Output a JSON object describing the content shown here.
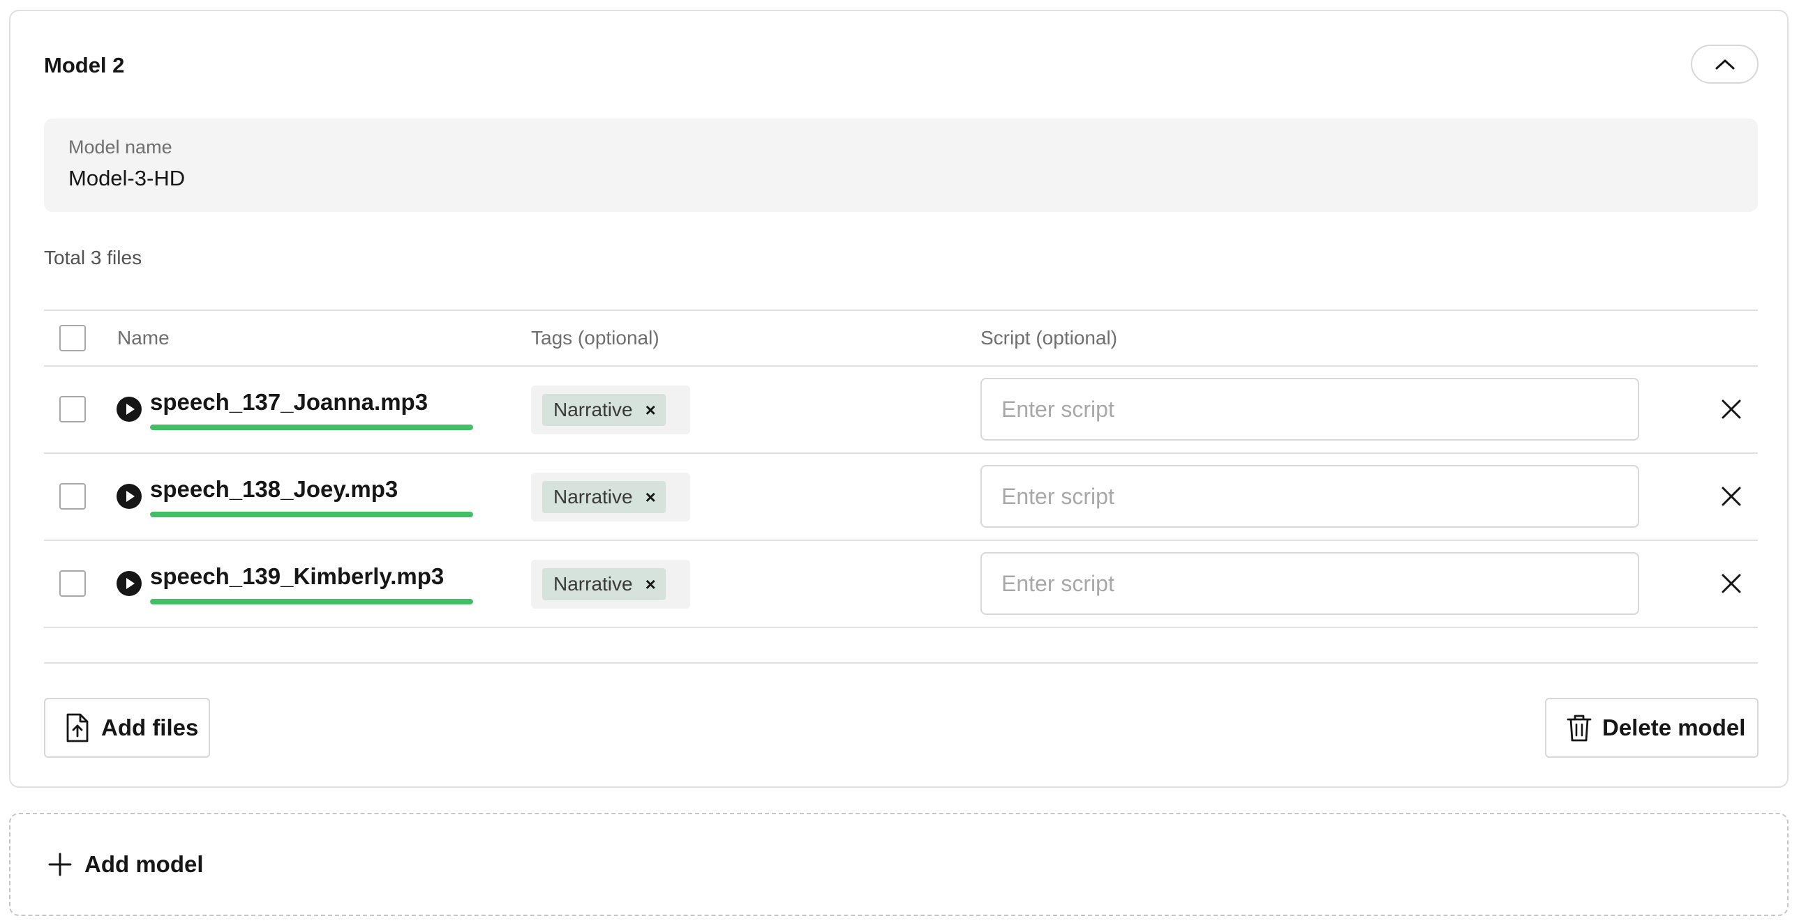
{
  "model": {
    "title": "Model 2",
    "collapse_icon": "chevron-up-icon",
    "name_label": "Model name",
    "name_value": "Model-3-HD",
    "total_files": "Total 3 files"
  },
  "table": {
    "headers": {
      "name": "Name",
      "tags": "Tags (optional)",
      "script": "Script (optional)"
    },
    "rows": [
      {
        "file": "speech_137_Joanna.mp3",
        "progress_percent": 100,
        "tag": "Narrative",
        "tag_remove": "×",
        "script_value": "",
        "script_placeholder": "Enter script"
      },
      {
        "file": "speech_138_Joey.mp3",
        "progress_percent": 100,
        "tag": "Narrative",
        "tag_remove": "×",
        "script_value": "",
        "script_placeholder": "Enter script"
      },
      {
        "file": "speech_139_Kimberly.mp3",
        "progress_percent": 100,
        "tag": "Narrative",
        "tag_remove": "×",
        "script_value": "",
        "script_placeholder": "Enter script"
      }
    ]
  },
  "actions": {
    "add_files": "Add files",
    "delete_model": "Delete model",
    "add_model": "Add model"
  },
  "colors": {
    "progress": "#42be65",
    "tag_bg": "#d6e2dc",
    "field_bg": "#f4f4f4",
    "border": "#e0e0e0"
  }
}
